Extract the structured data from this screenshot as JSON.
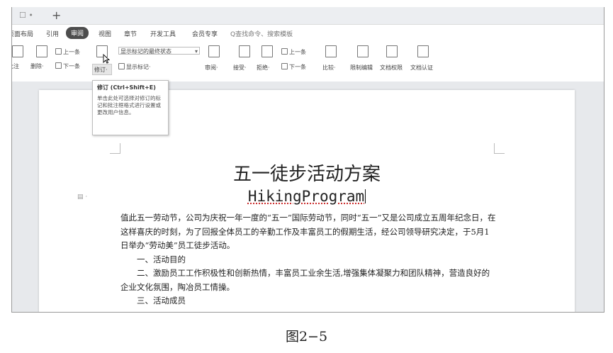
{
  "tabbar": {
    "doc_tab": "☐ •",
    "new_tab": "+"
  },
  "menu": {
    "items": [
      "页面布局",
      "引用",
      "审阅",
      "视图",
      "章节",
      "开发工具",
      "会员专享"
    ],
    "active_index": 2,
    "search": "Q查找命令、搜索模板"
  },
  "ribbon": {
    "insert_comment": "批注",
    "delete": "删除·",
    "prev_comment": "上一条",
    "next_comment": "下一条",
    "track_changes": "修订·",
    "display_select": "显示标记的最终状态",
    "show_markup": "显示标记·",
    "review": "审阅·",
    "accept": "接受·",
    "reject": "拒绝·",
    "prev_change": "上一条",
    "next_change": "下一条",
    "compare": "比较·",
    "restrict_edit": "限制编辑",
    "doc_permission": "文档权限",
    "doc_certify": "文档认证"
  },
  "tooltip": {
    "title": "修订 (Ctrl+Shift+E)",
    "body": "单击此处可选择对修订的标记和批注框格式进行设置或更改用户信息。"
  },
  "document": {
    "title": "五一徒步活动方案",
    "subtitle": "HikingProgram",
    "para1": "值此五一劳动节，公司为庆祝一年一度的“五一”国际劳动节，同时“五一”又是公司成立五周年纪念日，在这样喜庆的时刻，为了回报全体员工的辛勤工作及丰富员工的假期生活，经公司领导研究决定，于5月1日举办“劳动美”员工徒步活动。",
    "item1": "一、活动目的",
    "item2": "二、激励员工工作积极性和创新热情，丰富员工业余生活,增强集体凝聚力和团队精神，营造良好的企业文化氛围，陶冶员工情操。",
    "item3": "三、活动成员"
  },
  "caption": "图2−5"
}
